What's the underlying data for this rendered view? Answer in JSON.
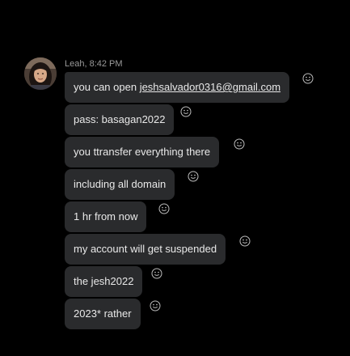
{
  "header": {
    "sender": "Leah",
    "time": "8:42 PM",
    "meta": "Leah, 8:42 PM"
  },
  "avatar": {
    "name": "Leah",
    "icon": "avatar-photo"
  },
  "messages": [
    {
      "prefix": "you can open ",
      "link": "jeshsalvador0316@gmail.com"
    },
    {
      "text": "pass: basagan2022"
    },
    {
      "text": "you ttransfer everything there"
    },
    {
      "text": "including all domain"
    },
    {
      "text": "1 hr from now"
    },
    {
      "text": "my account will get suspended"
    },
    {
      "text": "the jesh2022"
    },
    {
      "text": "2023* rather"
    }
  ],
  "reaction_icon": "smiley-face-icon",
  "colors": {
    "background": "#000000",
    "bubble": "#2a2b2d",
    "text": "#e9e9e9",
    "meta": "#9a9a9a"
  }
}
